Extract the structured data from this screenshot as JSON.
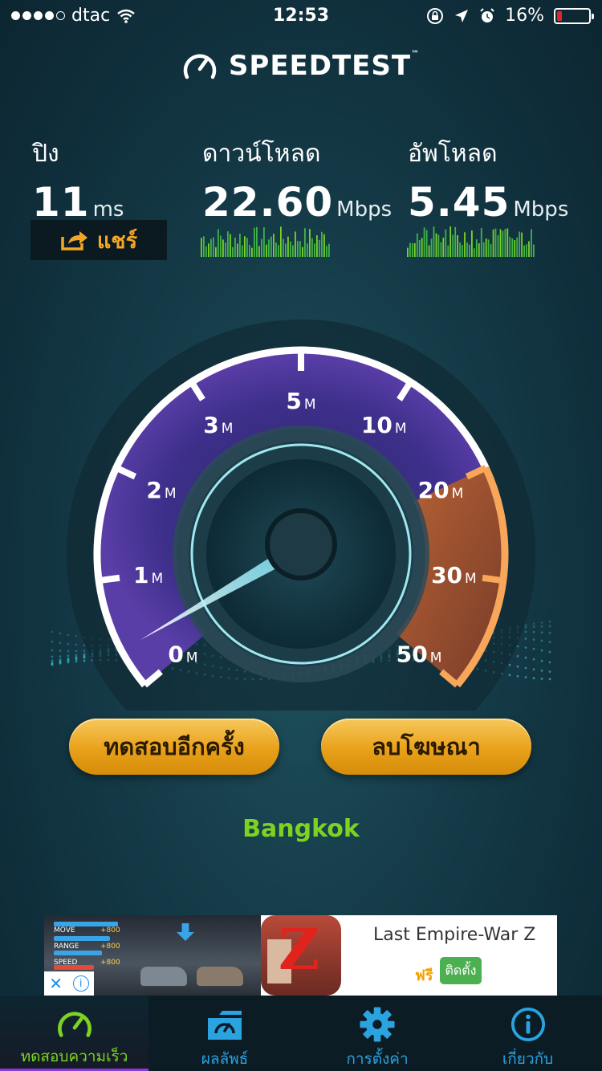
{
  "status_bar": {
    "carrier": "dtac",
    "time": "12:53",
    "battery_percent": "16%",
    "battery_level": 0.16,
    "battery_color": "#e0252b"
  },
  "app": {
    "logo_text": "SPEEDTEST",
    "trademark": "™"
  },
  "results": {
    "ping": {
      "label": "ปิง",
      "value": "11",
      "unit": "ms"
    },
    "download": {
      "label": "ดาวน์โหลด",
      "value": "22.60",
      "unit": "Mbps"
    },
    "upload": {
      "label": "อัพโหลด",
      "value": "5.45",
      "unit": "Mbps"
    },
    "share_label": "แชร์"
  },
  "gauge": {
    "ticks": [
      {
        "num": "0",
        "unit": "M"
      },
      {
        "num": "1",
        "unit": "M"
      },
      {
        "num": "2",
        "unit": "M"
      },
      {
        "num": "3",
        "unit": "M"
      },
      {
        "num": "5",
        "unit": "M"
      },
      {
        "num": "10",
        "unit": "M"
      },
      {
        "num": "20",
        "unit": "M"
      },
      {
        "num": "30",
        "unit": "M"
      },
      {
        "num": "50",
        "unit": "M"
      }
    ],
    "arc_color": "#6a3fb8",
    "highlight_color": "#e8843a"
  },
  "buttons": {
    "retest": "ทดสอบอีกครั้ง",
    "remove_ads": "ลบโฆษณา"
  },
  "server": {
    "location": "Bangkok"
  },
  "ad": {
    "title": "Last Empire-War Z",
    "price": "ฟรี",
    "install": "ติดตั้ง",
    "game_labels": [
      "MOVE",
      "RANGE",
      "SPEED"
    ],
    "game_values": [
      "+800",
      "+800",
      "+800"
    ]
  },
  "tabs": [
    {
      "label": "ทดสอบความเร็ว",
      "icon": "speedometer-icon",
      "active": true
    },
    {
      "label": "ผลลัพธ์",
      "icon": "results-folder-icon",
      "active": false
    },
    {
      "label": "การตั้งค่า",
      "icon": "gear-icon",
      "active": false
    },
    {
      "label": "เกี่ยวกับ",
      "icon": "info-icon",
      "active": false
    }
  ],
  "colors": {
    "accent_green": "#7ed321",
    "accent_orange": "#f6a623",
    "tab_blue": "#2aa3e0",
    "button_gold": "#e9a11a"
  }
}
